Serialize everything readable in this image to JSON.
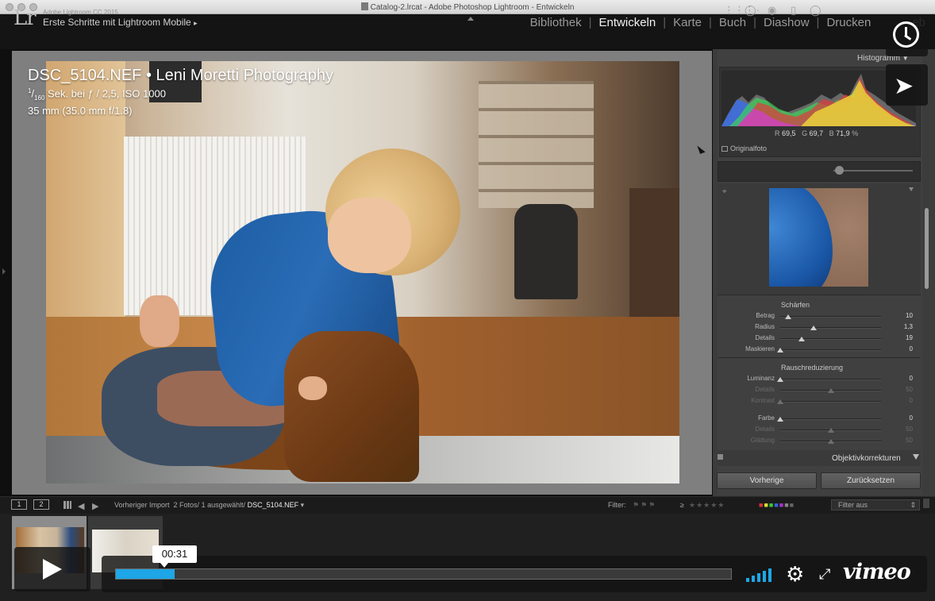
{
  "window": {
    "title": "Catalog-2.lrcat - Adobe Photoshop Lightroom - Entwickeln"
  },
  "header": {
    "logo": "Lr",
    "version": "Adobe Lightroom CC 2015",
    "identity_plate": "Erste Schritte mit Lightroom Mobile",
    "identity_arrow": "▸",
    "modules": [
      {
        "label": "Bibliothek",
        "active": false
      },
      {
        "label": "Entwickeln",
        "active": true
      },
      {
        "label": "Karte",
        "active": false
      },
      {
        "label": "Buch",
        "active": false
      },
      {
        "label": "Diashow",
        "active": false
      },
      {
        "label": "Drucken",
        "active": false
      },
      {
        "label": "eb",
        "active": false
      }
    ],
    "separator": "|"
  },
  "photo_info": {
    "title": "DSC_5104.NEF • Leni Moretti Photography",
    "exposure_prefix": "1",
    "exposure_denom": "160",
    "exposure_suffix": " Sek. bei ƒ / 2,5, ISO 1000",
    "lens": "35 mm (35.0 mm f/1.8)"
  },
  "histogram": {
    "label": "Histogramm",
    "readout": {
      "r_label": "R",
      "r": "69,5",
      "g_label": "G",
      "g": "69,7",
      "b_label": "B",
      "b": "71,9",
      "unit": "%"
    },
    "original_label": "Originalfoto",
    "colors": {
      "red": "#e23b3b",
      "green": "#3fd35a",
      "blue": "#3b6fe8",
      "yellow": "#f2e33a",
      "magenta": "#d33fd4",
      "cyan": "#3fd4d4",
      "gray": "#b5b5b5"
    }
  },
  "tools": [
    "crop-icon",
    "spot-removal-icon",
    "red-eye-icon",
    "graduated-filter-icon",
    "radial-filter-icon",
    "adjustment-brush-icon"
  ],
  "detail": {
    "sharpen": {
      "title": "Schärfen",
      "sliders": [
        {
          "label": "Betrag",
          "value": "10",
          "pos": 0.08,
          "dim": false
        },
        {
          "label": "Radius",
          "value": "1,3",
          "pos": 0.33,
          "dim": false
        },
        {
          "label": "Details",
          "value": "19",
          "pos": 0.21,
          "dim": false
        },
        {
          "label": "Maskieren",
          "value": "0",
          "pos": 0.0,
          "dim": false
        }
      ]
    },
    "noise": {
      "title": "Rauschreduzierung",
      "sliders": [
        {
          "label": "Luminanz",
          "value": "0",
          "pos": 0.0,
          "dim": false
        },
        {
          "label": "Details",
          "value": "50",
          "pos": 0.5,
          "dim": true
        },
        {
          "label": "Kontrast",
          "value": "0",
          "pos": 0.0,
          "dim": true
        },
        {
          "label": "Farbe",
          "value": "0",
          "pos": 0.0,
          "dim": false
        },
        {
          "label": "Details",
          "value": "50",
          "pos": 0.5,
          "dim": true
        },
        {
          "label": "Glättung",
          "value": "50",
          "pos": 0.5,
          "dim": true
        }
      ]
    }
  },
  "lens_corrections": {
    "label": "Objektivkorrekturen"
  },
  "buttons": {
    "previous": "Vorherige",
    "reset": "Zurücksetzen"
  },
  "filmstrip_bar": {
    "view1": "1",
    "view2": "2",
    "source": "Vorheriger Import",
    "count": "2 Fotos/ 1 ausgewählt/",
    "filename": "DSC_5104.NEF",
    "filename_arrow": "▾",
    "filter_label": "Filter:",
    "filter_ge": "≥",
    "filter_value": "Filter aus"
  },
  "video": {
    "time": "00:31",
    "progress": 0.095,
    "brand": "vimeo",
    "accent": "#1ea6e6"
  }
}
